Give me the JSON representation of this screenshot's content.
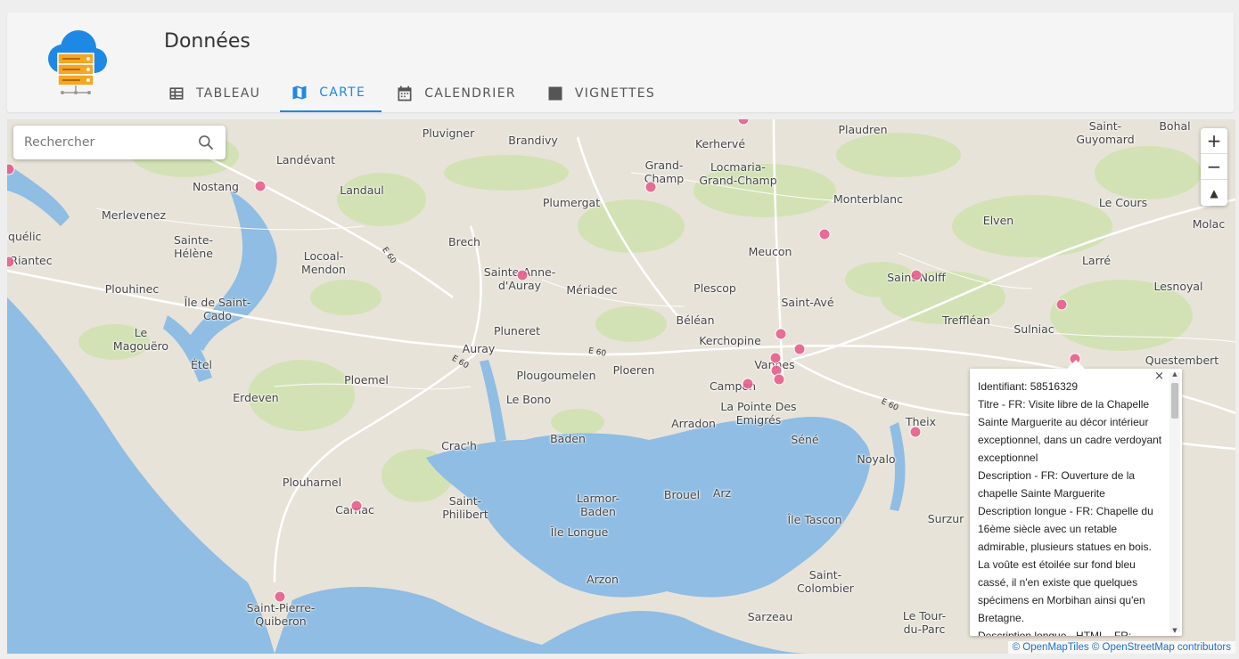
{
  "header": {
    "title": "Données",
    "tabs": [
      {
        "label": "TABLEAU",
        "icon": "table-icon",
        "active": false
      },
      {
        "label": "CARTE",
        "icon": "map-icon",
        "active": true
      },
      {
        "label": "CALENDRIER",
        "icon": "calendar-icon",
        "active": false
      },
      {
        "label": "VIGNETTES",
        "icon": "image-icon",
        "active": false
      }
    ]
  },
  "search": {
    "placeholder": "Rechercher"
  },
  "zoom": {
    "in": "+",
    "out": "−",
    "reset": "▲"
  },
  "map": {
    "places": [
      "Pluvigner",
      "Brandivy",
      "Kerhervé",
      "Plaudren",
      "Saint-\nGuyomard",
      "Bohal",
      "Landévant",
      "Nostang",
      "Landaul",
      "Grand-\nChamp",
      "Locmaria-\nGrand-Champ",
      "Plumergat",
      "Monterblanc",
      "Elven",
      "Le Cours",
      "Molac",
      "Merlevenez",
      "Sainte-\nHélène",
      "Locoal-\nMendon",
      "Brech",
      "Meucon",
      "Larré",
      "Riantec",
      "Plouhinec",
      "Île de Saint-\nCado",
      "Sainte-Anne-\nd'Auray",
      "Mériadec",
      "Plescop",
      "Saint-Avé",
      "Saint-Nolff",
      "Lesnoyal",
      "Le\nMagouëro",
      "Étel",
      "Pluneret",
      "Béléan",
      "Kerchopine",
      "Treffléan",
      "Sulniac",
      "Auray",
      "Vannes",
      "Questembert",
      "Ploemel",
      "Plougoumelen",
      "Ploeren",
      "Campen",
      "Erdeven",
      "Le Bono",
      "Arradon",
      "La Pointe Des\nEmigrés",
      "Theix",
      "Baden",
      "Séné",
      "Noyalo",
      "Crac'h",
      "Plouharnel",
      "Saint-\nPhilibert",
      "Larmor-\nBaden",
      "Brouel",
      "Arz",
      "Carnac",
      "Île Longue",
      "Île Tascon",
      "Surzur",
      "Arzon",
      "Saint-\nColombier",
      "Saint-Pierre-\nQuiberon",
      "Sarzeau",
      "Le Tour-\ndu-Parc",
      "iquélic"
    ],
    "roads": [
      "E 60",
      "E 60",
      "E 60",
      "E 60"
    ],
    "attribution": "© OpenMapTiles © OpenStreetMap contributors"
  },
  "popup": {
    "close": "×",
    "text": "Identifiant: 58516329\nTitre - FR: Visite libre de la Chapelle Sainte Marguerite au décor intérieur exceptionnel, dans un cadre verdoyant exceptionnel\nDescription - FR: Ouverture de la chapelle Sainte Marguerite\nDescription longue - FR: Chapelle du 16ème siècle avec un retable admirable, plusieurs statues en bois. La voûte est étoilée sur fond bleu cassé, il n'en existe que quelques spécimens en Morbihan ainsi qu'en Bretagne.\nDescription longue - HTML - FR:"
  },
  "colors": {
    "accent": "#1e88e5",
    "water": "#8fbde3",
    "land": "#e7e3d9",
    "green": "#c9dfa8",
    "marker": "#e8608d"
  }
}
